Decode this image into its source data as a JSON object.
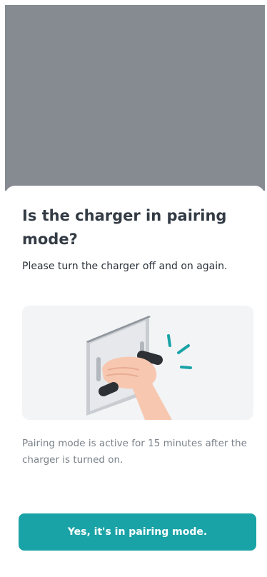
{
  "dialog": {
    "title": "Is the charger in pairing mode?",
    "subtitle": "Please turn the charger off and on again.",
    "illustration_icon": "hand-turning-charger-switch-icon",
    "info": "Pairing mode is active for 15 minutes after the charger is turned on.",
    "confirm_label": "Yes, it's in pairing mode."
  },
  "colors": {
    "backdrop": "#868b91",
    "accent": "#1aa3a7",
    "title": "#333b45",
    "muted": "#7a8189",
    "illustration_bg": "#f3f4f6"
  }
}
